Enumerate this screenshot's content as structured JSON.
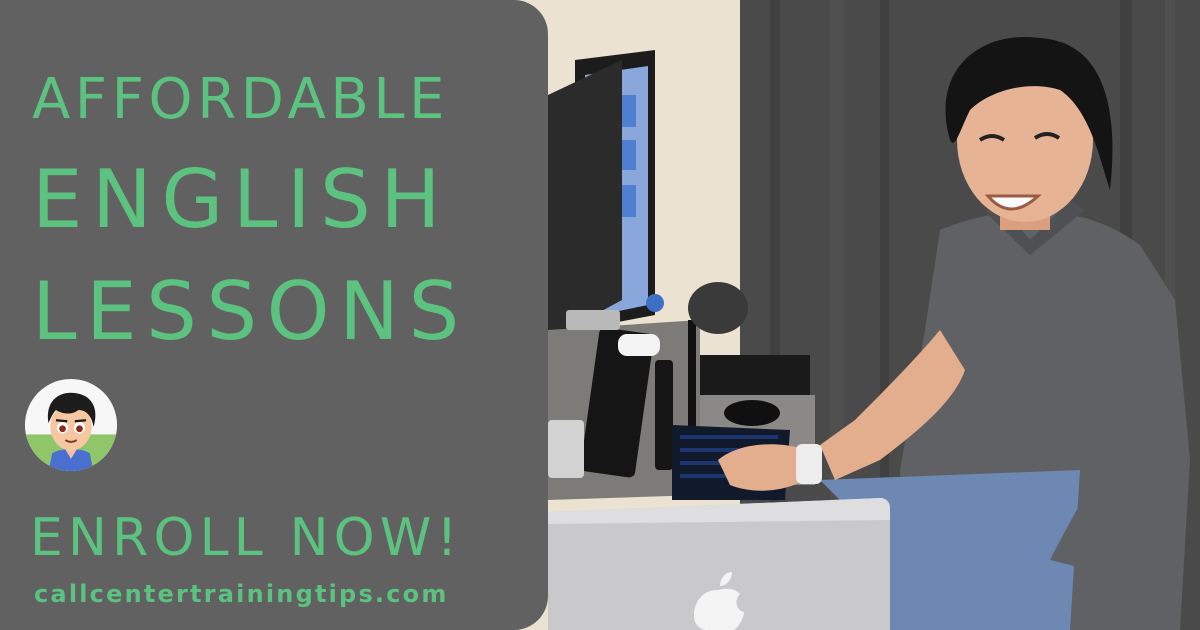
{
  "banner": {
    "headline_line1": "AFFORDABLE",
    "headline_line2": "ENGLISH",
    "headline_line3": "LESSONS",
    "cta": "ENROLL NOW!",
    "website": "callcentertrainingtips.com"
  },
  "colors": {
    "panel": "#616161",
    "accent_green": "#5cc27f"
  },
  "icons": {
    "avatar": "cartoon-man-avatar-icon",
    "laptop_logo": "apple-logo-icon"
  }
}
